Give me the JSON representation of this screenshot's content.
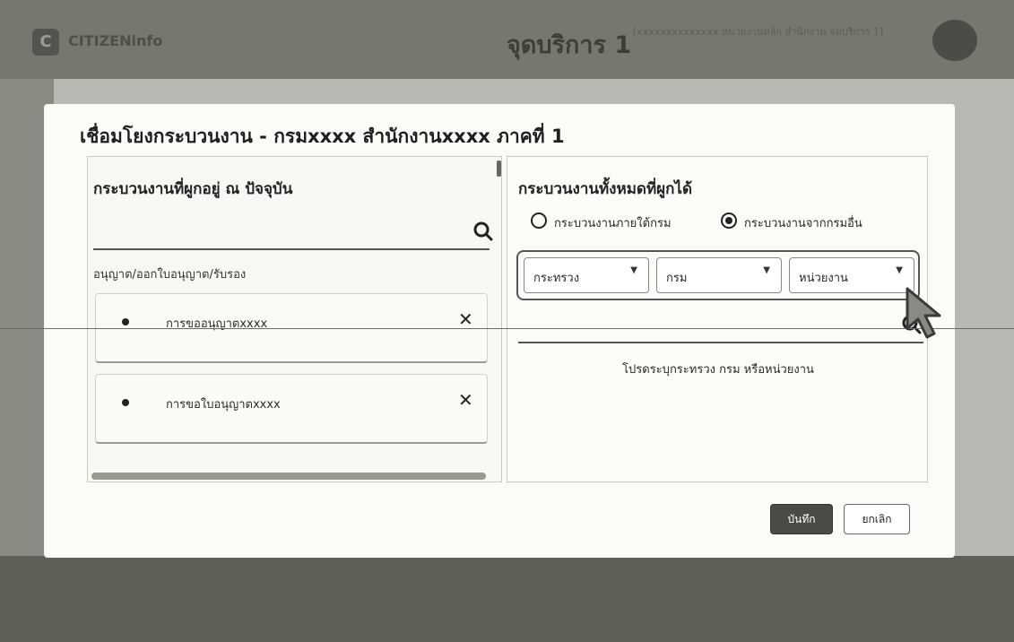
{
  "app": {
    "logo_letter": "C",
    "name": "CITIZENinfo",
    "title": "จุดบริการ 1",
    "subtitle": "[xxxxxxxxxxxxxx หน่วยงานหลัก สำนักงาน จุดบริการ 1]"
  },
  "modal": {
    "title": "เชื่อมโยงกระบวนงาน - กรมxxxx สำนักงานxxxx ภาคที่ 1",
    "left_panel": {
      "heading": "กระบวนงานที่ผูกอยู่ ณ ปัจจุบัน",
      "category": "อนุญาต/ออกใบอนุญาต/รับรอง",
      "items": [
        {
          "label": "การขออนุญาตxxxx",
          "remove": "✕"
        },
        {
          "label": "การขอใบอนุญาตxxxx",
          "remove": "✕"
        }
      ]
    },
    "right_panel": {
      "heading": "กระบวนงานทั้งหมดที่ผูกได้",
      "radios": [
        {
          "label": "กระบวนงานภายใต้กรม",
          "checked": false
        },
        {
          "label": "กระบวนงานจากกรมอื่น",
          "checked": true
        }
      ],
      "selects": [
        {
          "value": "กระทรวง"
        },
        {
          "value": "กรม"
        },
        {
          "value": "หน่วยงาน"
        }
      ],
      "hint": "โปรดระบุกระทรวง กรม หรือหน่วยงาน"
    },
    "buttons": {
      "save": "บันทึก",
      "cancel": "ยกเลิก"
    }
  }
}
